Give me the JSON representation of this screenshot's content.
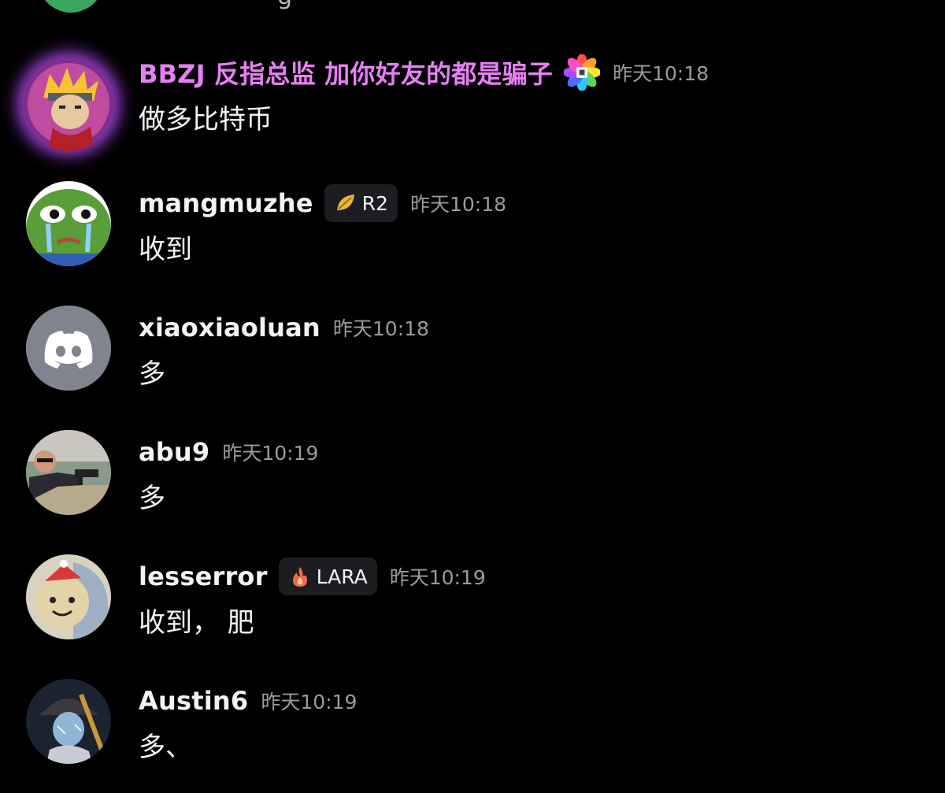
{
  "top_partial": {
    "text": "g"
  },
  "messages": [
    {
      "username": "BBZJ 反指总监 加你好友的都是骗子",
      "time": "昨天10:18",
      "content": "做多比特币"
    },
    {
      "username": "mangmuzhe",
      "tag": "R2",
      "time": "昨天10:18",
      "content": "收到"
    },
    {
      "username": "xiaoxiaoluan",
      "time": "昨天10:18",
      "content": "多"
    },
    {
      "username": "abu9",
      "time": "昨天10:19",
      "content": "多"
    },
    {
      "username": "lesserror",
      "tag": "LARA",
      "time": "昨天10:19",
      "content": "收到， 肥"
    },
    {
      "username": "Austin6",
      "time": "昨天10:19",
      "content": "多、"
    }
  ],
  "colors": {
    "background": "#000000",
    "highlight_name": "#e77ff5",
    "timestamp": "#9a9ba1",
    "tag_bg": "#1c1d21",
    "discord_default_avatar": "#80848e"
  },
  "icons": {
    "decoration": "rainbow-flower-icon",
    "tag_r2": "leaf-icon",
    "tag_lara": "flame-icon",
    "default_avatar": "discord-logo-icon"
  }
}
